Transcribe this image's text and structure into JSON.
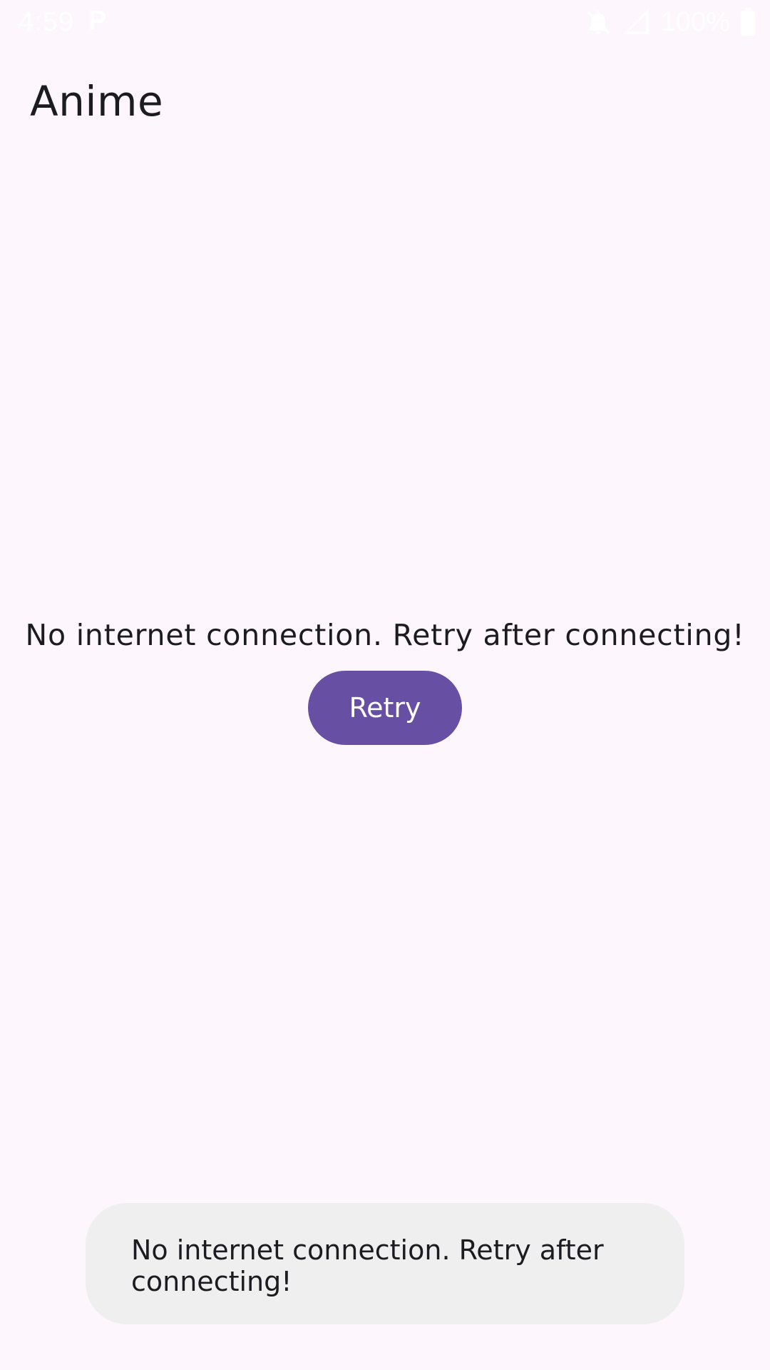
{
  "status_bar": {
    "time": "4:59",
    "notification_icon": "p-icon",
    "icons": [
      "notifications-off-icon",
      "signal-icon",
      "battery-icon"
    ],
    "battery": "100%"
  },
  "app_bar": {
    "title": "Anime"
  },
  "main": {
    "message": "No internet connection. Retry after connecting!",
    "retry_label": "Retry"
  },
  "snackbar": {
    "message": "No internet connection. Retry after connecting!"
  },
  "colors": {
    "background": "#fdf6fd",
    "primary": "#6750a4",
    "snackbar_bg": "#efefef",
    "text": "#1c1b1f"
  }
}
